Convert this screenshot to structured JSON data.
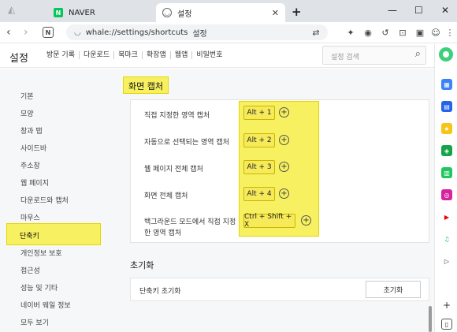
{
  "tabs": [
    {
      "label": "NAVER",
      "favicon": "naver-icon",
      "color": "#03c75a"
    },
    {
      "label": "설정",
      "favicon": "whale-icon"
    }
  ],
  "window": {
    "minimize": "—",
    "maximize": "☐",
    "close": "✕",
    "new_tab": "+"
  },
  "address": {
    "url": "whale://settings/shortcuts",
    "page_label": "설정"
  },
  "header": {
    "title": "설정",
    "nav": [
      "방문 기록",
      "다운로드",
      "북마크",
      "확장앱",
      "웹앱",
      "비밀번호"
    ],
    "search_placeholder": "설정 검색"
  },
  "sidebar": {
    "items": [
      "기본",
      "모양",
      "창과 탭",
      "사이드바",
      "주소창",
      "웹 페이지",
      "다운로드와 캡처",
      "마우스",
      "단축키",
      "개인정보 보호",
      "접근성",
      "성능 및 기타",
      "네이버 웨일 정보",
      "모두 보기"
    ],
    "active": "단축키"
  },
  "capture": {
    "section_title": "화면 캡처",
    "rows": [
      {
        "label": "직접 지정한 영역 캡처",
        "key": "Alt + 1"
      },
      {
        "label": "자동으로 선택되는 영역 캡처",
        "key": "Alt + 2"
      },
      {
        "label": "웹 페이지 전체 캡처",
        "key": "Alt + 3"
      },
      {
        "label": "화면 전체 캡처",
        "key": "Alt + 4"
      },
      {
        "label_line1": "백그라운드 모드에서 직접 지정",
        "label_line2": "한 영역 캡처",
        "key": "Ctrl + Shift + X"
      }
    ]
  },
  "reset": {
    "section_title": "초기화",
    "label": "단축키 초기화",
    "button": "초기화"
  },
  "colors": {
    "highlight": "#f7f061",
    "accent": "#03c75a"
  }
}
